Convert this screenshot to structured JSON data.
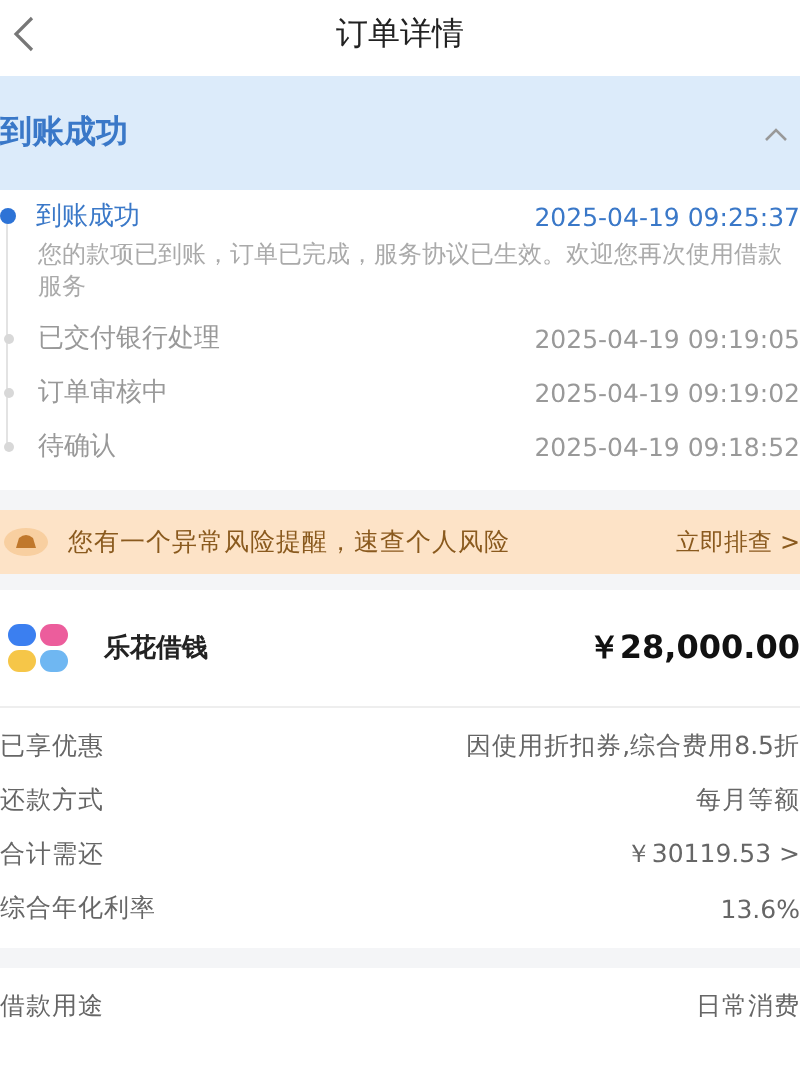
{
  "header": {
    "title": "订单详情"
  },
  "status": {
    "title": "到账成功",
    "expanded": true
  },
  "timeline": [
    {
      "title": "到账成功",
      "time": "2025-04-19 09:25:37",
      "active": true,
      "note": "您的款项已到账，订单已完成，服务协议已生效。欢迎您再次使用借款服务"
    },
    {
      "title": "已交付银行处理",
      "time": "2025-04-19 09:19:05",
      "active": false
    },
    {
      "title": "订单审核中",
      "time": "2025-04-19 09:19:02",
      "active": false
    },
    {
      "title": "待确认",
      "time": "2025-04-19 09:18:52",
      "active": false
    }
  ],
  "risk_banner": {
    "text": "您有一个异常风险提醒，速查个人风险",
    "action": "立即排查 >"
  },
  "product": {
    "name": "乐花借钱",
    "amount": "￥28,000.00"
  },
  "details": [
    {
      "label": "已享优惠",
      "value": "因使用折扣券,综合费用8.5折"
    },
    {
      "label": "还款方式",
      "value": "每月等额"
    },
    {
      "label": "合计需还",
      "value": "￥30119.53 >"
    },
    {
      "label": "综合年化利率",
      "value": "13.6%"
    }
  ],
  "details_2": [
    {
      "label": "借款用途",
      "value": "日常消费"
    }
  ]
}
